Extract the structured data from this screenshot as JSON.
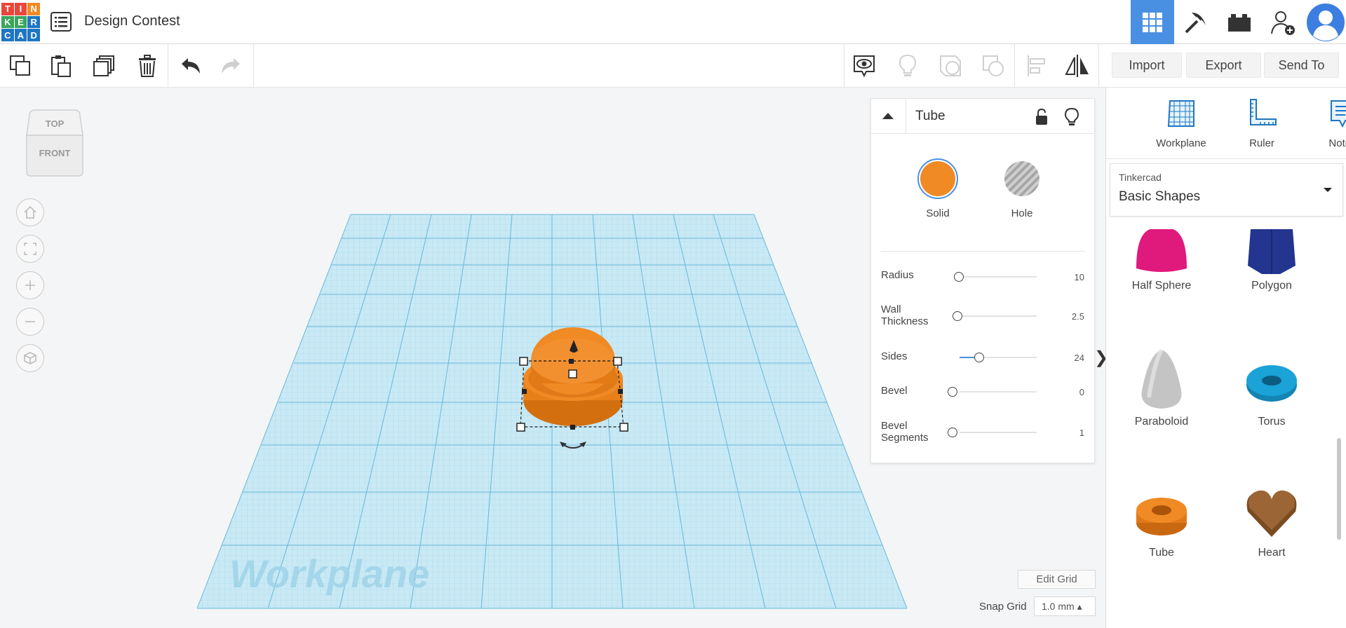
{
  "app": {
    "logo_letters": [
      "T",
      "I",
      "N",
      "K",
      "E",
      "R",
      "C",
      "A",
      "D"
    ],
    "logo_colors": [
      "#e8473b",
      "#e8473b",
      "#f08a24",
      "#3ba55c",
      "#3ba55c",
      "#1f76c2",
      "#1f76c2",
      "#1f76c2",
      "#1f76c2"
    ],
    "design_title": "Design Contest",
    "accent": "#4a90e2"
  },
  "top_nav": {
    "icons": [
      "grid-view-icon",
      "build-pickaxe-icon",
      "bricks-icon",
      "add-user-icon",
      "user-avatar-icon"
    ]
  },
  "toolbar": {
    "left_tools": [
      "copy-icon",
      "paste-icon",
      "duplicate-icon",
      "delete-icon",
      "undo-icon",
      "redo-icon"
    ],
    "right_tools": [
      "show-hide-icon",
      "lightbulb-icon",
      "group-icon",
      "ungroup-icon",
      "align-icon",
      "mirror-icon"
    ],
    "import_label": "Import",
    "export_label": "Export",
    "sendto_label": "Send To"
  },
  "view_cube": {
    "top": "TOP",
    "front": "FRONT"
  },
  "canvas": {
    "workplane_text": "Workplane",
    "edit_grid_label": "Edit Grid",
    "snap_grid_label": "Snap Grid",
    "snap_grid_value": "1.0 mm ▴",
    "shape_color": "#f08a24"
  },
  "inspector": {
    "title": "Tube",
    "solid_label": "Solid",
    "hole_label": "Hole",
    "params": [
      {
        "label": "Radius",
        "value": "10"
      },
      {
        "label": "Wall\nThickness",
        "value": "2.5"
      },
      {
        "label": "Sides",
        "value": "24"
      },
      {
        "label": "Bevel",
        "value": "0"
      },
      {
        "label": "Bevel\nSegments",
        "value": "1"
      }
    ]
  },
  "right_panel": {
    "workplane_label": "Workplane",
    "ruler_label": "Ruler",
    "notes_label": "Notes",
    "library_category": "Tinkercad",
    "library_name": "Basic Shapes",
    "shapes": [
      {
        "name": "Half Sphere",
        "color": "#e0197d"
      },
      {
        "name": "Polygon",
        "color": "#23358f"
      },
      {
        "name": "Paraboloid",
        "color": "#c4c4c4"
      },
      {
        "name": "Torus",
        "color": "#1ba2d6"
      },
      {
        "name": "Tube",
        "color": "#f08a24"
      },
      {
        "name": "Heart",
        "color": "#8b5a2b"
      }
    ]
  }
}
